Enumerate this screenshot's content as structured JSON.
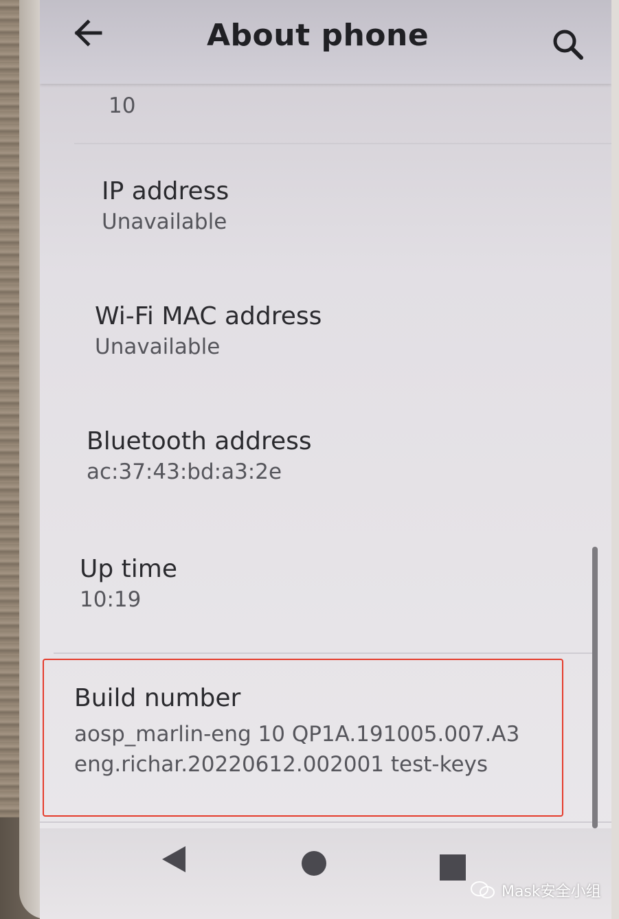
{
  "header": {
    "title": "About phone",
    "back_icon": "arrow-left-icon",
    "search_icon": "search-icon"
  },
  "partial_item": {
    "value": "10"
  },
  "items": [
    {
      "label": "IP address",
      "value": "Unavailable"
    },
    {
      "label": "Wi-Fi MAC address",
      "value": "Unavailable"
    },
    {
      "label": "Bluetooth address",
      "value": "ac:37:43:bd:a3:2e"
    },
    {
      "label": "Up time",
      "value": "10:19"
    }
  ],
  "build": {
    "label": "Build number",
    "value_line1": "aosp_marlin-eng 10 QP1A.191005.007.A3",
    "value_line2": "eng.richar.20220612.002001 test-keys"
  },
  "colors": {
    "highlight": "#e53a2a",
    "appbar": "#c9c6ce"
  },
  "navigation": {
    "icons": [
      "nav-back-icon",
      "nav-home-icon",
      "nav-recents-icon"
    ]
  },
  "watermark": {
    "text": "Mask安全小组"
  }
}
